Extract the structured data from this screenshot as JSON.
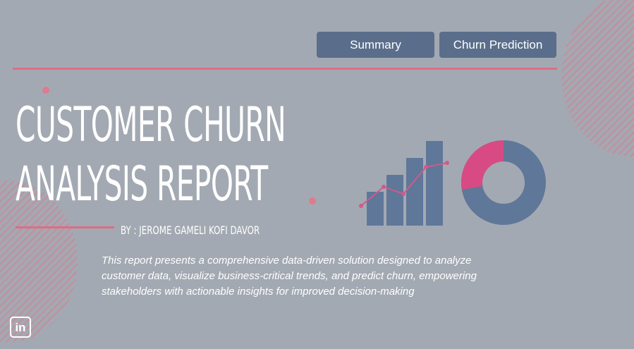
{
  "nav": {
    "summary_label": "Summary",
    "churn_label": "Churn Prediction"
  },
  "hero": {
    "title_line1": "CUSTOMER CHURN",
    "title_line2": "ANALYSIS REPORT",
    "author": "BY : JEROME GAMELI KOFI DAVOR",
    "description": "This report presents a comprehensive data-driven solution designed to analyze customer data, visualize business-critical trends, and predict churn, empowering stakeholders with actionable insights for improved decision-making"
  },
  "icons": {
    "illustration": "bar-line-donut-chart-icon",
    "social": "linkedin-icon"
  },
  "social": {
    "linkedin_text": "in"
  },
  "colors": {
    "background": "#a3a9b2",
    "accent": "#df6d83",
    "button": "#5a6e8b",
    "chart_blue": "#5f7799",
    "chart_pink": "#d84a84"
  }
}
